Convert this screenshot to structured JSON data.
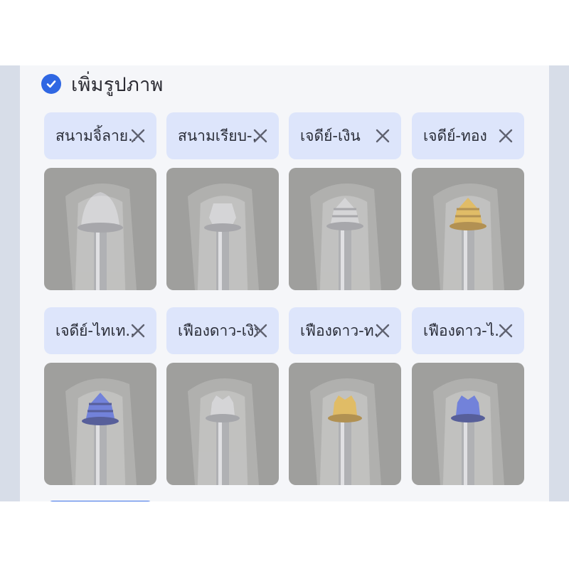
{
  "section": {
    "title": "เพิ่มรูปภาพ",
    "checked": true
  },
  "colors": {
    "accent": "#2f67e3",
    "chip_bg": "#dde5fb",
    "panel_bg": "#f5f6f9"
  },
  "cards": [
    {
      "label": "สนามจิ้ลาย...",
      "cap": "silver-dome"
    },
    {
      "label": "สนามเรียบ-...",
      "cap": "silver-hex"
    },
    {
      "label": "เจดีย์-เงิน",
      "cap": "silver-pagoda"
    },
    {
      "label": "เจดีย์-ทอง",
      "cap": "gold-pagoda"
    },
    {
      "label": "เจดีย์-ไทเท...",
      "cap": "titanium-pagoda"
    },
    {
      "label": "เฟืองดาว-เงิน",
      "cap": "silver-star"
    },
    {
      "label": "เฟืองดาว-ท...",
      "cap": "gold-star"
    },
    {
      "label": "เฟืองดาว-ไ...",
      "cap": "titanium-star"
    }
  ]
}
